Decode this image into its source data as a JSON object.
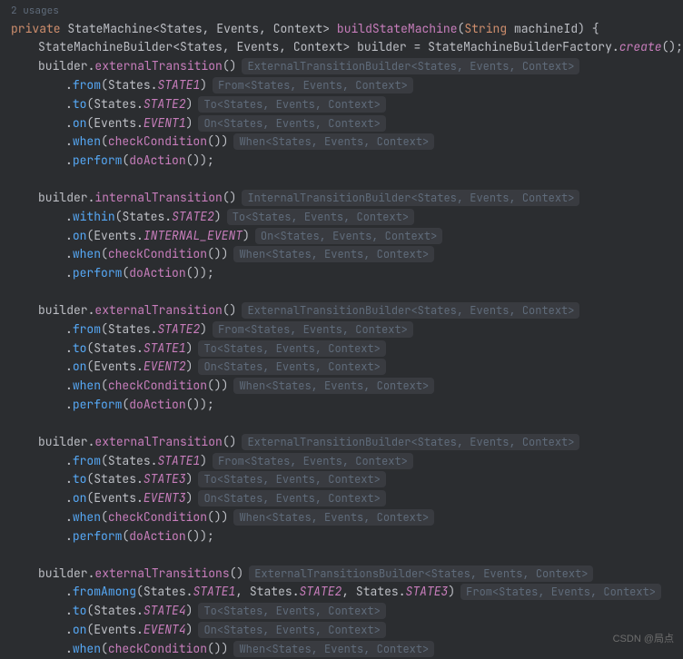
{
  "usages_hint": "2 usages",
  "sig": {
    "kw": "private",
    "ret": "StateMachine",
    "g1": "States",
    "g2": "Events",
    "g3": "Context",
    "name": "buildStateMachine",
    "ptype": "String",
    "pname": "machineId"
  },
  "l2": {
    "type": "StateMachineBuilder",
    "g1": "States",
    "g2": "Events",
    "g3": "Context",
    "var": "builder",
    "factory": "StateMachineBuilderFactory",
    "create": "create"
  },
  "hints": {
    "ext": "ExternalTransitionBuilder<States, Events, Context>",
    "exts": "ExternalTransitionsBuilder<States, Events, Context>",
    "int": "InternalTransitionBuilder<States, Events, Context>",
    "from": "From<States, Events, Context>",
    "to": "To<States, Events, Context>",
    "on": "On<States, Events, Context>",
    "when": "When<States, Events, Context>"
  },
  "b1": {
    "call": "externalTransition",
    "from": "from",
    "from_arg": "States",
    "from_val": "STATE1",
    "to": "to",
    "to_arg": "States",
    "to_val": "STATE2",
    "on": "on",
    "on_arg": "Events",
    "on_val": "EVENT1",
    "when": "when",
    "when_fn": "checkCondition",
    "perform": "perform",
    "perform_fn": "doAction"
  },
  "b2": {
    "call": "internalTransition",
    "within": "within",
    "within_arg": "States",
    "within_val": "STATE2",
    "on": "on",
    "on_arg": "Events",
    "on_val": "INTERNAL_EVENT",
    "when": "when",
    "when_fn": "checkCondition",
    "perform": "perform",
    "perform_fn": "doAction"
  },
  "b3": {
    "call": "externalTransition",
    "from": "from",
    "from_arg": "States",
    "from_val": "STATE2",
    "to": "to",
    "to_arg": "States",
    "to_val": "STATE1",
    "on": "on",
    "on_arg": "Events",
    "on_val": "EVENT2",
    "when": "when",
    "when_fn": "checkCondition",
    "perform": "perform",
    "perform_fn": "doAction"
  },
  "b4": {
    "call": "externalTransition",
    "from": "from",
    "from_arg": "States",
    "from_val": "STATE1",
    "to": "to",
    "to_arg": "States",
    "to_val": "STATE3",
    "on": "on",
    "on_arg": "Events",
    "on_val": "EVENT3",
    "when": "when",
    "when_fn": "checkCondition",
    "perform": "perform",
    "perform_fn": "doAction"
  },
  "b5": {
    "call": "externalTransitions",
    "fromAmong": "fromAmong",
    "fa_arg1_c": "States",
    "fa_arg1_v": "STATE1",
    "fa_arg2_c": "States",
    "fa_arg2_v": "STATE2",
    "fa_arg3_c": "States",
    "fa_arg3_v": "STATE3",
    "to": "to",
    "to_arg": "States",
    "to_val": "STATE4",
    "on": "on",
    "on_arg": "Events",
    "on_val": "EVENT4",
    "when": "when",
    "when_fn": "checkCondition"
  },
  "watermark": "CSDN @局点"
}
